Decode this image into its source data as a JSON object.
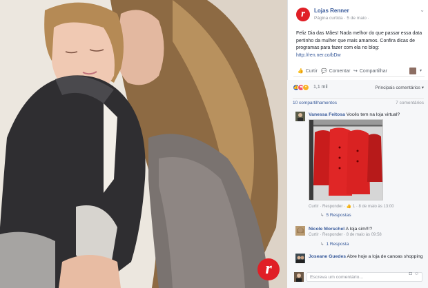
{
  "post": {
    "page_name": "Lojas Renner",
    "meta": "Página curtida · 5 de maio ·",
    "text_main": "Feliz Dia das Mães! Nada melhor do que passar essa data pertinho da mulher que mais amamos. Confira dicas de programas para fazer com ela no blog:",
    "link": "http://ren.ner.co/bDw"
  },
  "actions": {
    "like": "Curtir",
    "comment": "Comentar",
    "share": "Compartilhar"
  },
  "feedback": {
    "reaction_count": "1,1 mil",
    "sort_label": "Principais comentários ▾",
    "shares": "10 compartilhamentos",
    "comments": "7 comentários"
  },
  "comments": [
    {
      "author": "Vanessa Feitosa",
      "text": "Vocês tem na loja virtual?",
      "meta_links": "Curtir · Responder",
      "meta_count": "1",
      "meta_date": "8 de maio às 13:00",
      "replies": "5 Respostas"
    },
    {
      "author": "Nicole Morschel",
      "text": "A loja sim!!!?",
      "meta_links": "Curtir · Responder",
      "meta_date": "8 de maio às 09:58",
      "replies": "1 Resposta"
    },
    {
      "author": "Joseane Guedes",
      "text": "Abre hoje a loja de canoas shopping"
    }
  ],
  "composer": {
    "placeholder": "Escreva um comentário..."
  },
  "colors": {
    "brand_red": "#e01f26",
    "facebook_blue": "#365899",
    "like_blue": "#4267b2"
  }
}
